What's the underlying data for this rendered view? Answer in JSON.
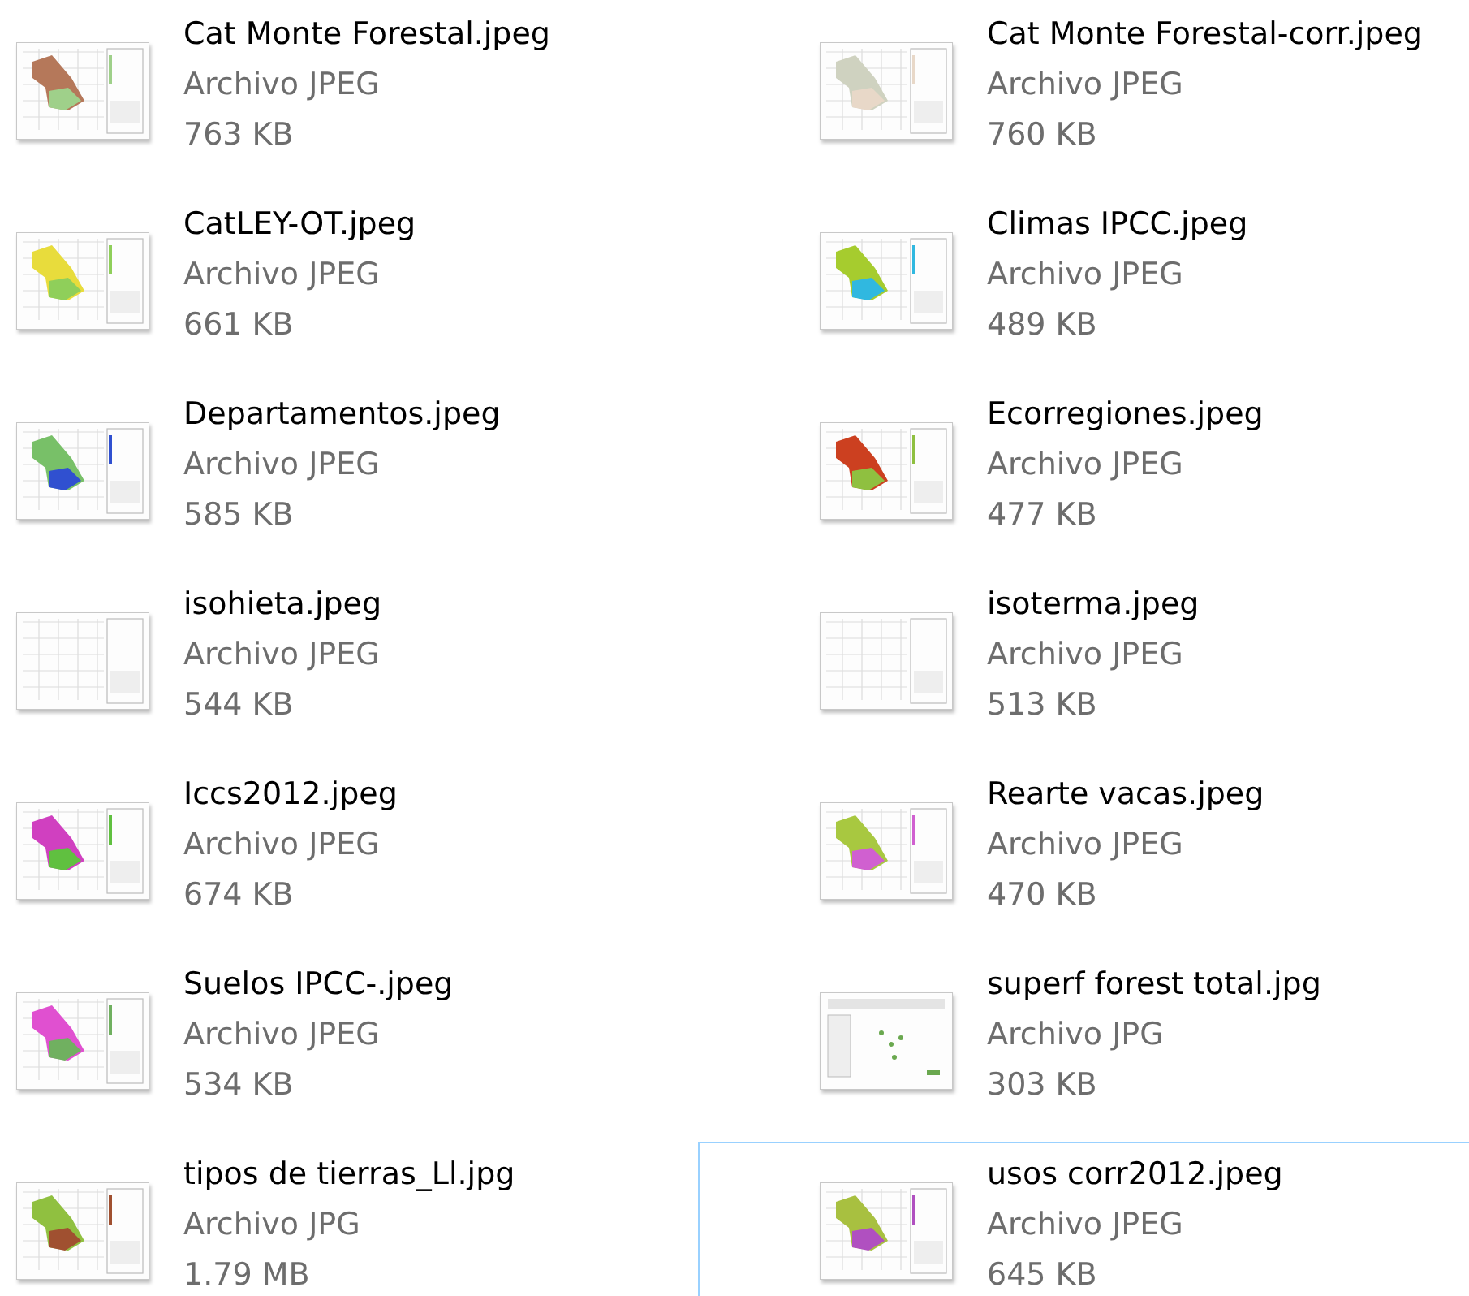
{
  "files": [
    {
      "name": "Cat Monte Forestal.jpeg",
      "type": "Archivo JPEG",
      "size": "763 KB",
      "selected": false
    },
    {
      "name": "Cat Monte Forestal-corr.jpeg",
      "type": "Archivo JPEG",
      "size": "760 KB",
      "selected": false
    },
    {
      "name": "CatLEY-OT.jpeg",
      "type": "Archivo JPEG",
      "size": "661 KB",
      "selected": false
    },
    {
      "name": "Climas IPCC.jpeg",
      "type": "Archivo JPEG",
      "size": "489 KB",
      "selected": false
    },
    {
      "name": "Departamentos.jpeg",
      "type": "Archivo JPEG",
      "size": "585 KB",
      "selected": false
    },
    {
      "name": "Ecorregiones.jpeg",
      "type": "Archivo JPEG",
      "size": "477 KB",
      "selected": false
    },
    {
      "name": "isohieta.jpeg",
      "type": "Archivo JPEG",
      "size": "544 KB",
      "selected": false
    },
    {
      "name": "isoterma.jpeg",
      "type": "Archivo JPEG",
      "size": "513 KB",
      "selected": false
    },
    {
      "name": "Iccs2012.jpeg",
      "type": "Archivo JPEG",
      "size": "674 KB",
      "selected": false
    },
    {
      "name": "Rearte vacas.jpeg",
      "type": "Archivo JPEG",
      "size": "470 KB",
      "selected": false
    },
    {
      "name": "Suelos IPCC-.jpeg",
      "type": "Archivo JPEG",
      "size": "534 KB",
      "selected": false
    },
    {
      "name": "superf forest total.jpg",
      "type": "Archivo JPG",
      "size": "303 KB",
      "selected": false
    },
    {
      "name": "tipos de tierras_Ll.jpg",
      "type": "Archivo JPG",
      "size": "1.79 MB",
      "selected": false
    },
    {
      "name": "usos corr2012.jpeg",
      "type": "Archivo JPEG",
      "size": "645 KB",
      "selected": true
    }
  ]
}
